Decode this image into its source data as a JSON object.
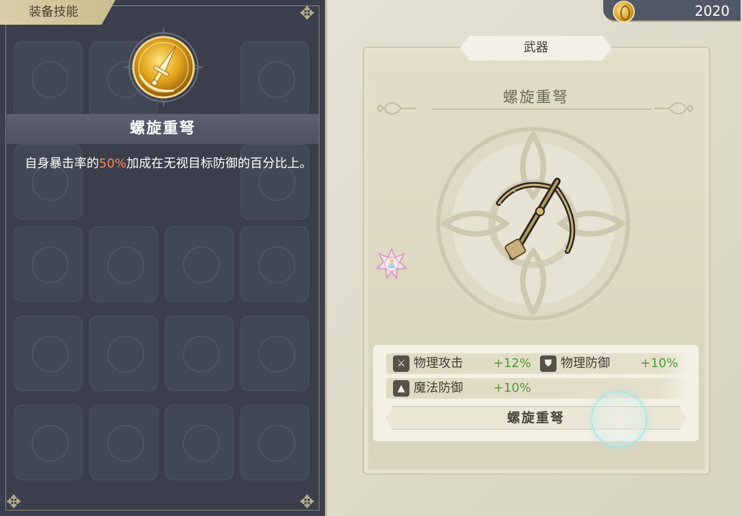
{
  "currency": {
    "icon": "gold-coin-icon",
    "value": "2020"
  },
  "left_panel": {
    "tab_label": "装备技能",
    "skill": {
      "icon": "dagger-medal-icon",
      "name": "螺旋重弩",
      "description": {
        "part1": "自身暴击率的",
        "highlight": "50%",
        "part2": "加成在无视目标防御的百分比上。"
      }
    }
  },
  "item_card": {
    "category": "武器",
    "name": "螺旋重弩",
    "image": "crossbow-icon",
    "badge": "rarity-badge-icon",
    "stats": [
      {
        "icon": "sword-icon",
        "name": "物理攻击",
        "value": "+12%"
      },
      {
        "icon": "shield-icon",
        "name": "物理防御",
        "value": "+10%"
      },
      {
        "icon": "wizard-hat-icon",
        "name": "魔法防御",
        "value": "+10%"
      }
    ],
    "set_button": "螺旋重弩"
  },
  "colors": {
    "highlight": "#f08a5d",
    "stat_positive": "#4f9a3a",
    "panel_dark": "#3a3f4b"
  }
}
